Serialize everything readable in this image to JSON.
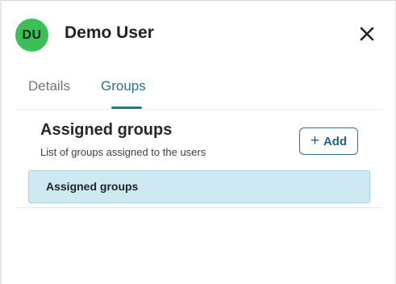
{
  "header": {
    "avatar_initials": "DU",
    "avatar_color": "#3dbf57",
    "user_name": "Demo User",
    "close_icon": "close-icon"
  },
  "tabs": [
    {
      "label": "Details",
      "active": false
    },
    {
      "label": "Groups",
      "active": true
    }
  ],
  "accent_color": "#2b7390",
  "section": {
    "title": "Assigned groups",
    "subtitle": "List of groups assigned to the users",
    "add_button": {
      "icon": "plus-icon",
      "icon_glyph": "+",
      "label": "Add"
    }
  },
  "table": {
    "columns": [
      "Assigned groups"
    ],
    "rows": []
  }
}
